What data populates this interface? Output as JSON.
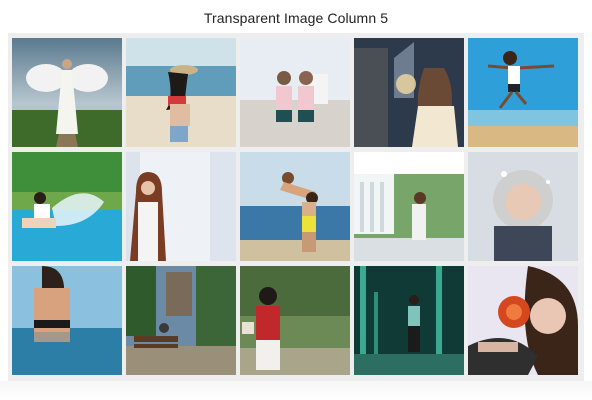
{
  "page": {
    "title": "Transparent Image Column 5"
  },
  "gallery": {
    "columns": 5,
    "rows": 3,
    "images": [
      {
        "subject": "angel-woman-in-field"
      },
      {
        "subject": "woman-on-beach-with-hat"
      },
      {
        "subject": "two-women-on-balcony"
      },
      {
        "subject": "woman-by-castle-at-night"
      },
      {
        "subject": "woman-jumping-on-beach"
      },
      {
        "subject": "girl-splashing-in-pool"
      },
      {
        "subject": "woman-by-white-curtain"
      },
      {
        "subject": "couple-on-beach"
      },
      {
        "subject": "woman-on-white-porch"
      },
      {
        "subject": "woman-in-fur-hood-winter"
      },
      {
        "subject": "woman-in-water"
      },
      {
        "subject": "man-on-park-bench"
      },
      {
        "subject": "girl-in-red-jacket-in-woods"
      },
      {
        "subject": "woman-in-green-park-at-night"
      },
      {
        "subject": "woman-with-red-flower"
      }
    ]
  }
}
